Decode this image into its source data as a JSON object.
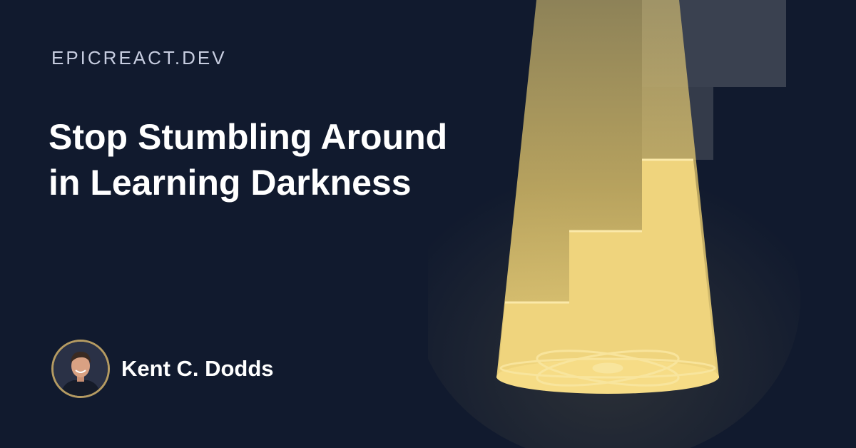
{
  "site_name": "EPICREACT.DEV",
  "headline": "Stop Stumbling Around in Learning Darkness",
  "author": {
    "name": "Kent C. Dodds",
    "avatar_icon": "author-photo"
  },
  "illustration": {
    "icon": "spotlight-staircase-react-logo",
    "logo_icon": "react-atom-icon"
  },
  "colors": {
    "background": "#111a2e",
    "site_text": "#c7cde0",
    "headline_text": "#ffffff",
    "avatar_ring": "#b59b62",
    "spotlight": "#f3d77a"
  }
}
